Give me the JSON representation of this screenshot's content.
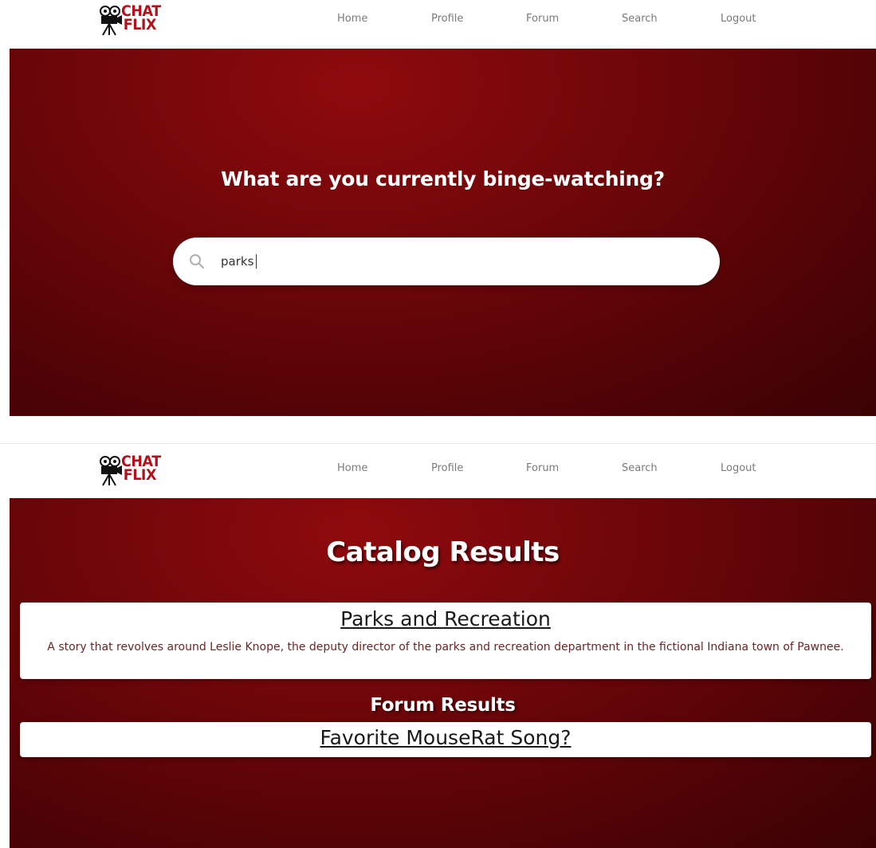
{
  "brand": {
    "logo_line1": "CHAT",
    "logo_line2": "FLIX",
    "accent_color": "#b3121d",
    "icon": "film-camera-icon"
  },
  "nav": {
    "items": [
      {
        "label": "Home"
      },
      {
        "label": "Profile"
      },
      {
        "label": "Forum"
      },
      {
        "label": "Search"
      },
      {
        "label": "Logout"
      }
    ]
  },
  "search_page": {
    "heading": "What are you currently binge-watching?",
    "search": {
      "value": "parks",
      "icon": "search-icon"
    }
  },
  "results_page": {
    "catalog_heading": "Catalog Results",
    "catalog_results": [
      {
        "title": "Parks and Recreation",
        "description": "A story that revolves around Leslie Knope, the deputy director of the parks and recreation department in the fictional Indiana town of Pawnee."
      }
    ],
    "forum_heading": "Forum Results",
    "forum_results": [
      {
        "title": "Favorite MouseRat Song?"
      }
    ]
  },
  "colors": {
    "hero_dark": "#3a0204",
    "hero_light": "#8f0a0d",
    "nav_text": "#7a7a7a"
  }
}
